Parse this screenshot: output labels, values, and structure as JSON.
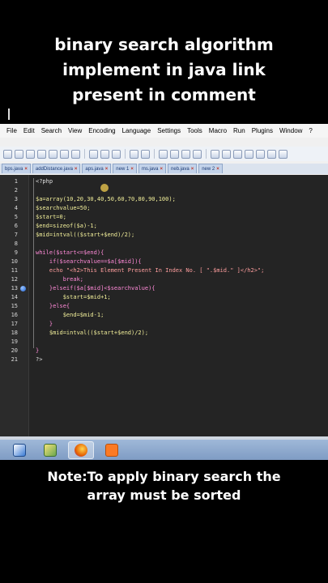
{
  "caption": {
    "top_lines": [
      "binary search algorithm",
      "implement in java link",
      "present in comment"
    ],
    "bottom_lines": [
      "Note:To apply binary search the",
      "array must be sorted"
    ]
  },
  "menu": [
    "File",
    "Edit",
    "Search",
    "View",
    "Encoding",
    "Language",
    "Settings",
    "Tools",
    "Macro",
    "Run",
    "Plugins",
    "Window",
    "?"
  ],
  "tabs": [
    {
      "label": "bps.java"
    },
    {
      "label": "addDistance.java"
    },
    {
      "label": "aps.java"
    },
    {
      "label": "new 1"
    },
    {
      "label": "ms.java"
    },
    {
      "label": "neb.java"
    },
    {
      "label": "new 2"
    }
  ],
  "editor": {
    "line_numbers": [
      "1",
      "2",
      "3",
      "4",
      "5",
      "6",
      "7",
      "8",
      "9",
      "10",
      "11",
      "12",
      "13",
      "14",
      "15",
      "16",
      "17",
      "18",
      "19",
      "20",
      "21"
    ],
    "bookmark_line": "13",
    "lines": [
      "<?php",
      "",
      "$a=array(10,20,30,40,50,60,70,80,90,100);",
      "$searchvalue=50;",
      "$start=0;",
      "$end=sizeof($a)-1;",
      "$mid=intval(($start+$end)/2);",
      "",
      "while($start<=$end){",
      "    if($searchvalue==$a[$mid]){",
      "    echo \"<h2>This Element Present In Index No. [ \".$mid.\" ]</h2>\";",
      "        break;",
      "    }elseif($a[$mid]<$searchvalue){",
      "        $start=$mid+1;",
      "    }else{",
      "        $end=$mid-1;",
      "    }",
      "    $mid=intval(($start+$end)/2);",
      "",
      "}",
      "?>"
    ]
  },
  "taskbar": {
    "items": [
      {
        "icon": "video-player-icon",
        "color": "#3a7bd5"
      },
      {
        "icon": "paint-brush-icon",
        "color": "#6aa84f"
      },
      {
        "icon": "firefox-icon",
        "color": "#e66000"
      },
      {
        "icon": "xampp-icon",
        "color": "#fb7a24"
      }
    ]
  },
  "colors": {
    "editor_bg": "#242424",
    "variable": "#f2ef9a",
    "keyword": "#ff8ad8",
    "string": "#ff9e9e"
  }
}
